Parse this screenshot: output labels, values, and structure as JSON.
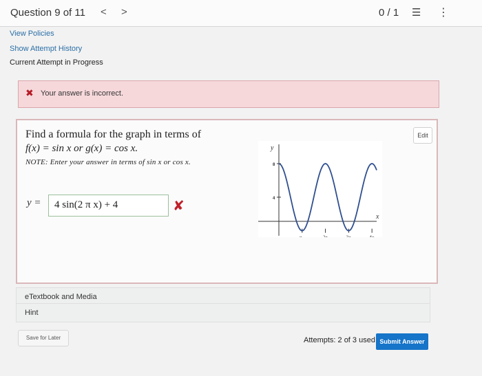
{
  "header": {
    "question_label": "Question 9 of 11",
    "prev_glyph": "<",
    "next_glyph": ">",
    "score": "0 / 1",
    "list_glyph": "☰",
    "more_glyph": "⋮"
  },
  "links": {
    "view_policies": "View Policies",
    "attempt_history": "Show Attempt History"
  },
  "attempt_status": "Current Attempt in Progress",
  "feedback": {
    "icon": "✖",
    "message": "Your answer is incorrect."
  },
  "question": {
    "edit_label": "Edit",
    "prompt_line1": "Find a formula for the graph in terms of",
    "prompt_line2": "f(x) = sin x  or  g(x) = cos x.",
    "note": "NOTE: Enter your answer in terms of sin x or cos x.",
    "answer_label": "y =",
    "answer_value": "4 sin(2 π x) + 4",
    "wrong_icon": "✘"
  },
  "chart_data": {
    "type": "line",
    "title": "",
    "xlabel": "x",
    "ylabel": "y",
    "x_ticks": [
      "π",
      "2π",
      "3π",
      "4π"
    ],
    "y_ticks": [
      "4",
      "8"
    ],
    "y_tick_values": [
      4,
      8
    ],
    "xlim": [
      0,
      13.2
    ],
    "ylim": [
      -0.6,
      10.3
    ],
    "curve": "8 cos²(x/2)",
    "series": [
      {
        "name": "",
        "x": [
          0,
          1.571,
          3.1416,
          4.712,
          6.2832,
          7.854,
          9.4248,
          10.996,
          12.5664,
          13.2
        ],
        "y": [
          8,
          4,
          0,
          4,
          8,
          4,
          0,
          4,
          8,
          7.8
        ]
      }
    ]
  },
  "sections": {
    "etextbook": "eTextbook and Media",
    "hint": "Hint"
  },
  "footer": {
    "save_label": "Save for Later",
    "attempts": "Attempts: 2 of 3 used",
    "submit_label": "Submit Answer"
  }
}
